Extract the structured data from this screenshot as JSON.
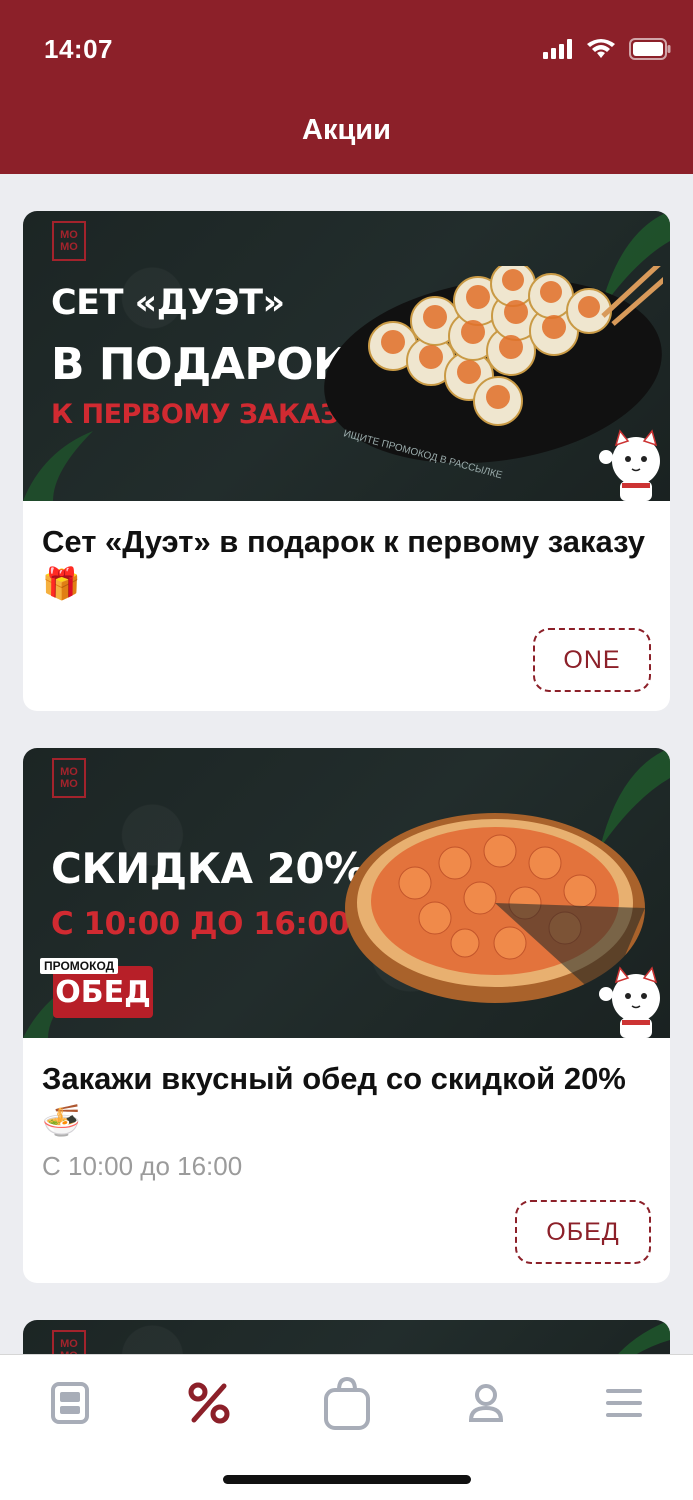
{
  "status_bar": {
    "time": "14:07"
  },
  "header": {
    "title": "Акции"
  },
  "promos": [
    {
      "banner": {
        "logo": "МО\nМО",
        "line1": "СЕТ «ДУЭТ»",
        "line2": "В ПОДАРОК!",
        "line3": "К ПЕРВОМУ ЗАКАЗУ",
        "caption": "ИЩИТЕ ПРОМОКОД В РАССЫЛКЕ"
      },
      "title": "Сет «Дуэт» в подарок к первому заказу🎁",
      "code": "ONE"
    },
    {
      "banner": {
        "logo": "МО\nМО",
        "line1": "СКИДКА 20%",
        "line2": "С 10:00 ДО 16:00",
        "promo_tag": "ПРОМОКОД",
        "promo_code": "ОБЕД"
      },
      "title": "Закажи вкусный обед со скидкой 20%🍜",
      "subtitle": "С 10:00 до 16:00",
      "code": "ОБЕД"
    },
    {
      "banner": {
        "logo": "МО\nМО"
      }
    }
  ],
  "tabbar": {
    "items": [
      {
        "icon": "menu-book-icon"
      },
      {
        "icon": "percent-icon",
        "active": true
      },
      {
        "icon": "bag-icon"
      },
      {
        "icon": "profile-icon"
      },
      {
        "icon": "hamburger-icon"
      }
    ]
  },
  "colors": {
    "accent": "#8c2029",
    "background": "#ecedf1",
    "banner_red": "#d12a31"
  }
}
